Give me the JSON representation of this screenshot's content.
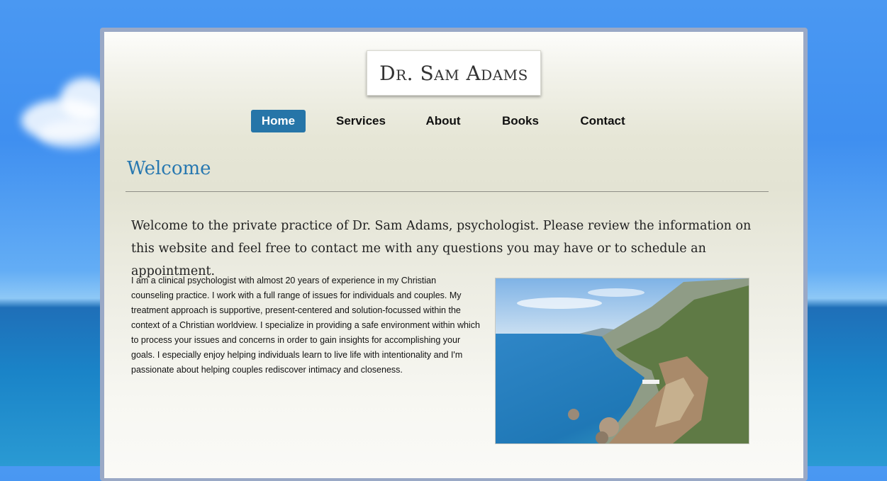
{
  "site": {
    "logo_text": "Dr. Sam Adams"
  },
  "nav": {
    "items": [
      {
        "label": "Home",
        "active": true
      },
      {
        "label": "Services",
        "active": false
      },
      {
        "label": "About",
        "active": false
      },
      {
        "label": "Books",
        "active": false
      },
      {
        "label": "Contact",
        "active": false
      }
    ]
  },
  "main": {
    "heading": "Welcome",
    "intro": "Welcome to the private practice of Dr. Sam Adams, psychologist. Please review the information on this website and feel free to contact me with any questions you may have or to schedule an appointment.",
    "body": "I am a clinical psychologist with almost 20 years of experience in my Christian counseling practice. I work with a full range of issues for individuals and couples. My treatment approach is supportive, present-centered and solution-focussed within the context of a Christian worldview. I specialize in providing a safe environment within which to process your issues and concerns in order to gain insights for accomplishing your goals. I especially enjoy helping individuals learn to live life with intentionality and I'm passionate about helping couples rediscover intimacy and closeness.",
    "image": "coastline-photo"
  },
  "colors": {
    "accent": "#2675a8",
    "heading": "#2878b0"
  }
}
